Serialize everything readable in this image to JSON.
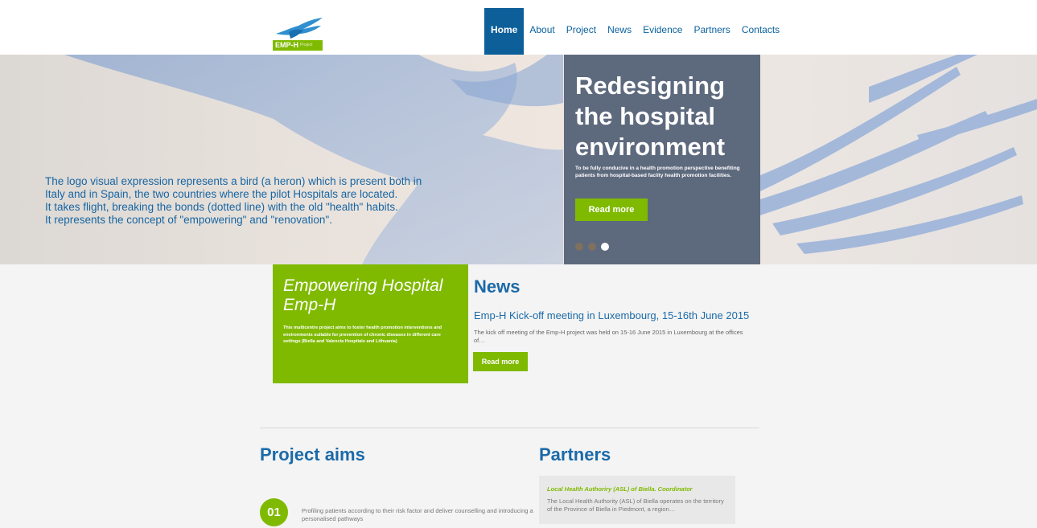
{
  "logo": {
    "text": "EMP-H",
    "sub": "Project"
  },
  "nav": {
    "items": [
      "Home",
      "About",
      "Project",
      "News",
      "Evidence",
      "Partners",
      "Contacts"
    ],
    "active": "Home"
  },
  "hero": {
    "lines": [
      "The logo visual expression represents a bird (a heron) which is present both in",
      "Italy and in Spain, the two countries where the pilot Hospitals are located.",
      "It takes flight, breaking the bonds (dotted line) with the old \"health\" habits.",
      "It represents the concept of \"empowering\" and \"renovation\"."
    ],
    "panel": {
      "title": "Redesigning the hospital environment",
      "subtitle": "To be fully conducive in a health promotion perspective benefiting patients from hospital-based faclity health promotion facilities.",
      "button": "Read more"
    },
    "slides": {
      "count": 3,
      "active": 3
    }
  },
  "intro": {
    "title": "Empowering Hospital Emp-H",
    "description": "This multicentre project aims to foster health promotion interventions and environments suitable for prevention of chronic diseases in different care settings (Biella and Valencia Hospitals and Lithuania)"
  },
  "news": {
    "heading": "News",
    "title": "Emp-H Kick-off meeting in Luxembourg, 15-16th June 2015",
    "excerpt": "The kick off meeting of the Emp-H project was held on 15-16 June 2015 in Luxembourg at the offices of…",
    "button": "Read more"
  },
  "aims": {
    "heading": "Project aims",
    "items": [
      {
        "number": "01",
        "text": "Profiling patients according to their risk factor and deliver counselling and introducing a personalised pathways"
      }
    ]
  },
  "partners": {
    "heading": "Partners",
    "items": [
      {
        "name": "Local Health Authoriry (ASL) of Biella. Coordinator",
        "description": "The Local Health Authority (ASL) of Biella operates on the territory of the Province of Biella in Piedmont, a region…"
      }
    ]
  },
  "colors": {
    "brand_blue": "#1b6aa8",
    "nav_active": "#0d5f99",
    "accent_green": "#7fba00"
  }
}
